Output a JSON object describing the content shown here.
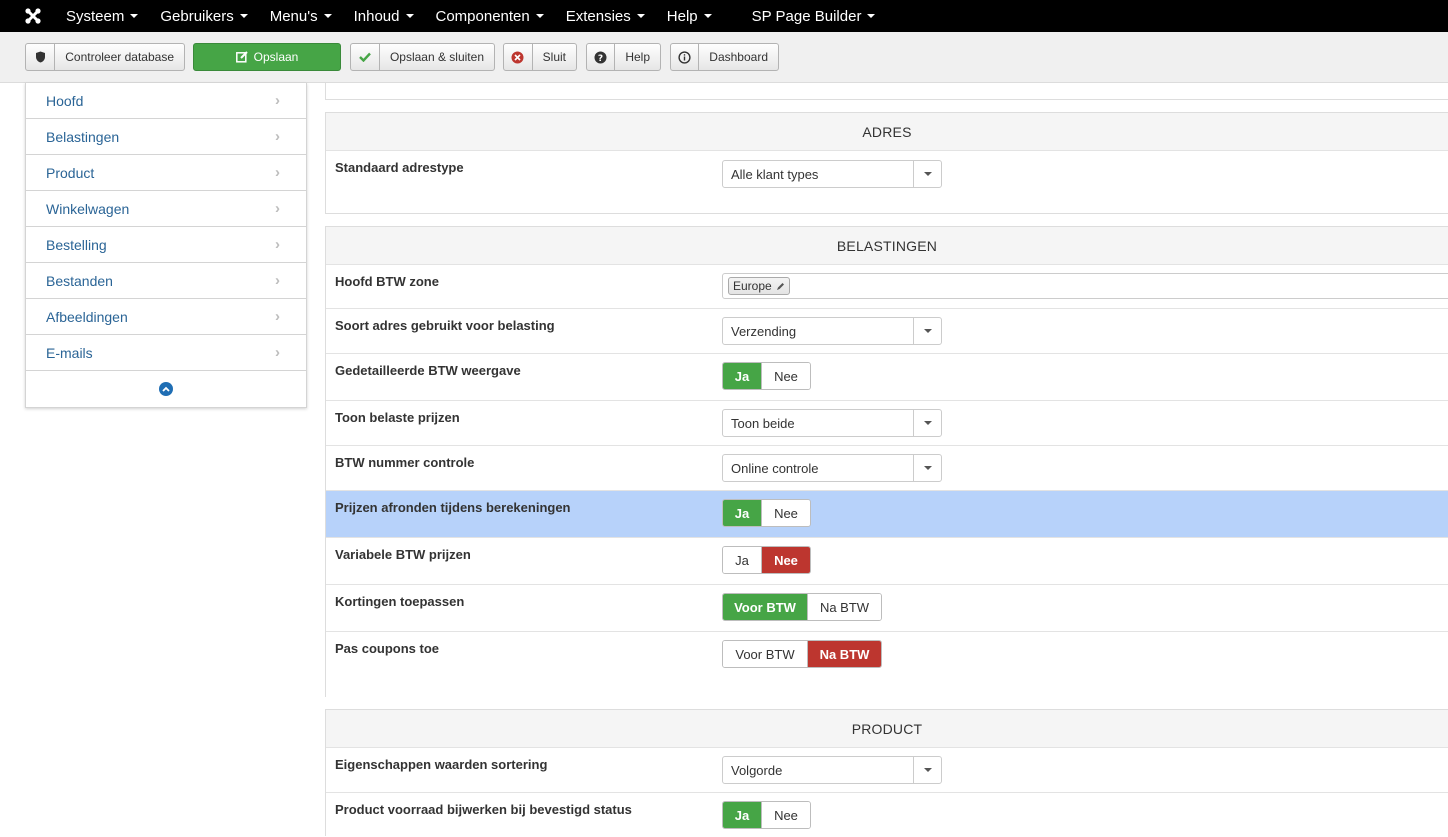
{
  "topnav": {
    "items": [
      "Systeem",
      "Gebruikers",
      "Menu's",
      "Inhoud",
      "Componenten",
      "Extensies",
      "Help",
      "SP Page Builder"
    ]
  },
  "toolbar": {
    "check_db": "Controleer database",
    "save": "Opslaan",
    "save_close": "Opslaan & sluiten",
    "close": "Sluit",
    "help": "Help",
    "dashboard": "Dashboard"
  },
  "sidebar": {
    "items": [
      "Hoofd",
      "Belastingen",
      "Product",
      "Winkelwagen",
      "Bestelling",
      "Bestanden",
      "Afbeeldingen",
      "E-mails"
    ]
  },
  "sections": {
    "adres": {
      "title": "ADRES",
      "default_address_type": {
        "label": "Standaard adrestype",
        "value": "Alle klant types"
      }
    },
    "belastingen": {
      "title": "BELASTINGEN",
      "main_vat_zone": {
        "label": "Hoofd BTW zone",
        "tag": "Europe"
      },
      "address_type_for_tax": {
        "label": "Soort adres gebruikt voor belasting",
        "value": "Verzending"
      },
      "detailed_vat_display": {
        "label": "Gedetailleerde BTW weergave",
        "yes": "Ja",
        "no": "Nee",
        "selected": "Ja"
      },
      "show_taxed_prices": {
        "label": "Toon belaste prijzen",
        "value": "Toon beide"
      },
      "vat_number_check": {
        "label": "BTW nummer controle",
        "value": "Online controle"
      },
      "round_prices": {
        "label": "Prijzen afronden tijdens berekeningen",
        "yes": "Ja",
        "no": "Nee",
        "selected": "Ja"
      },
      "variable_vat_prices": {
        "label": "Variabele BTW prijzen",
        "yes": "Ja",
        "no": "Nee",
        "selected": "Nee"
      },
      "apply_discounts": {
        "label": "Kortingen toepassen",
        "before": "Voor BTW",
        "after": "Na BTW",
        "selected": "Voor BTW"
      },
      "apply_coupons": {
        "label": "Pas coupons toe",
        "before": "Voor BTW",
        "after": "Na BTW",
        "selected": "Na BTW"
      }
    },
    "product": {
      "title": "PRODUCT",
      "property_sorting": {
        "label": "Eigenschappen waarden sortering",
        "value": "Volgorde"
      },
      "update_stock": {
        "label": "Product voorraad bijwerken bij bevestigd status",
        "yes": "Ja",
        "no": "Nee",
        "selected": "Ja"
      }
    }
  },
  "colors": {
    "green": "#46a546",
    "red": "#bd362f",
    "highlight": "#b7d2fa",
    "link": "#2a6496"
  }
}
